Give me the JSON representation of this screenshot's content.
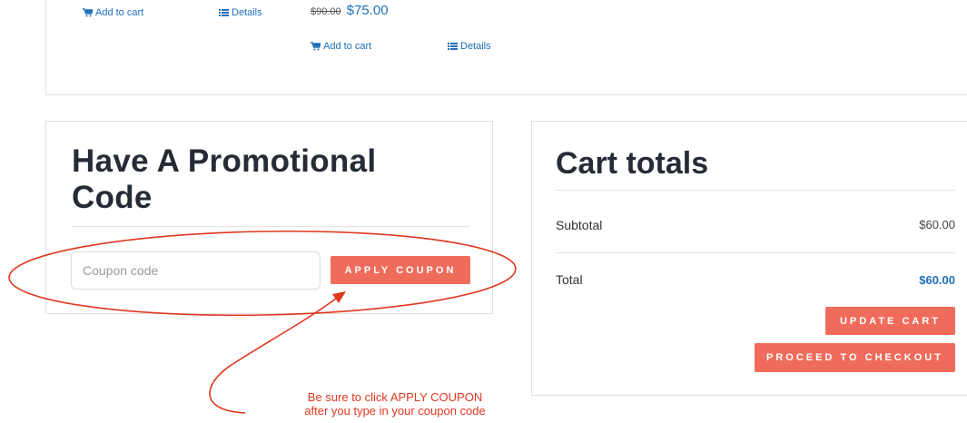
{
  "products": {
    "row1": {
      "add_to_cart": "Add to cart",
      "details": "Details"
    },
    "row2": {
      "old_price": "$90.00",
      "new_price": "$75.00",
      "add_to_cart": "Add to cart",
      "details": "Details"
    }
  },
  "promo": {
    "title": "Have A Promotional Code",
    "coupon_placeholder": "Coupon code",
    "apply_button": "APPLY COUPON"
  },
  "cart_totals": {
    "title": "Cart totals",
    "subtotal_label": "Subtotal",
    "subtotal_value": "$60.00",
    "total_label": "Total",
    "total_value": "$60.00",
    "update_button": "UPDATE CART",
    "checkout_button": "PROCEED TO CHECKOUT"
  },
  "annotation": {
    "line1": "Be sure to click APPLY COUPON",
    "line2": "after you type in your coupon code",
    "color": "#e0371f"
  },
  "colors": {
    "accent": "#ef6c5c",
    "link": "#1f6fb8",
    "heading": "#262b36"
  },
  "icons": {
    "cart": "cart-icon",
    "details": "list-icon"
  }
}
